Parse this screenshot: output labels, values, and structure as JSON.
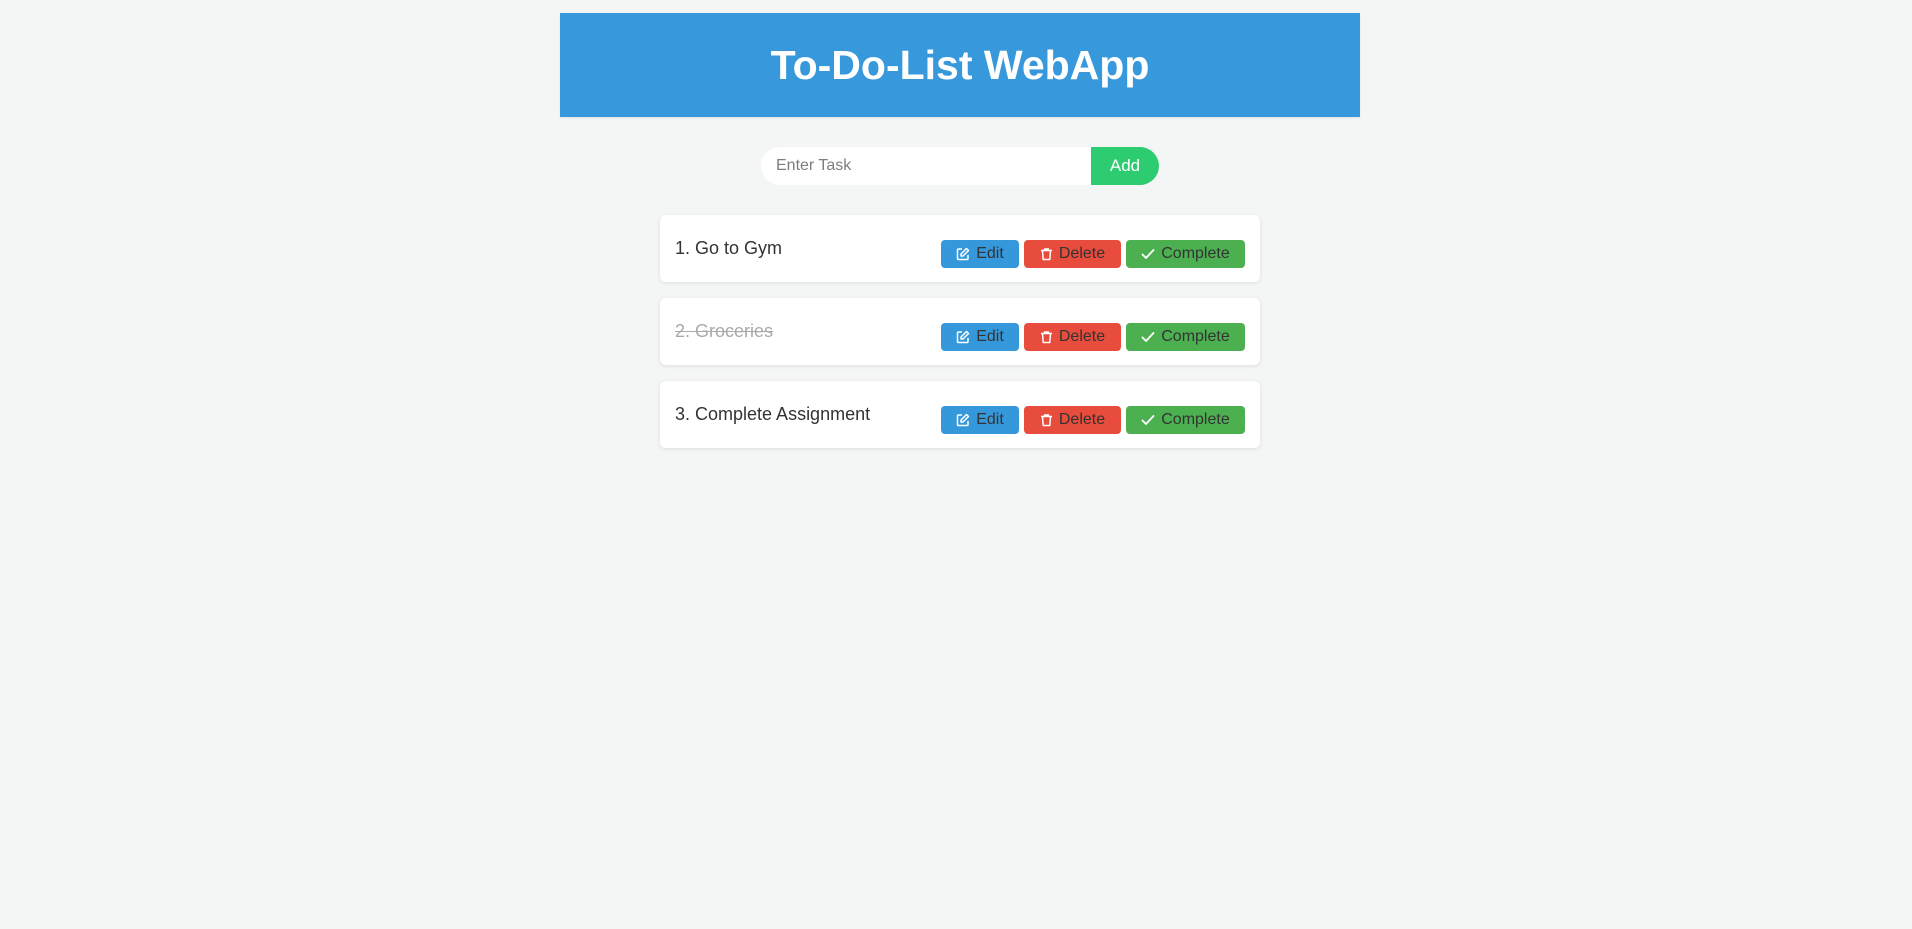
{
  "header": {
    "title": "To-Do-List WebApp"
  },
  "add_form": {
    "placeholder": "Enter Task",
    "value": "",
    "add_label": "Add"
  },
  "tasks": [
    {
      "text": "1. Go to Gym",
      "completed": false
    },
    {
      "text": "2. Groceries",
      "completed": true
    },
    {
      "text": "3. Complete Assignment",
      "completed": false
    }
  ],
  "actions": {
    "edit_label": "Edit",
    "delete_label": "Delete",
    "complete_label": "Complete",
    "edit_icon": "edit-icon",
    "delete_icon": "trash-icon",
    "complete_icon": "check-icon"
  },
  "colors": {
    "header": "#3799dc",
    "add_button": "#2ecc71",
    "edit": "#3498db",
    "delete": "#e74c3c",
    "complete": "#4caf50",
    "background": "#f4f6f5"
  }
}
